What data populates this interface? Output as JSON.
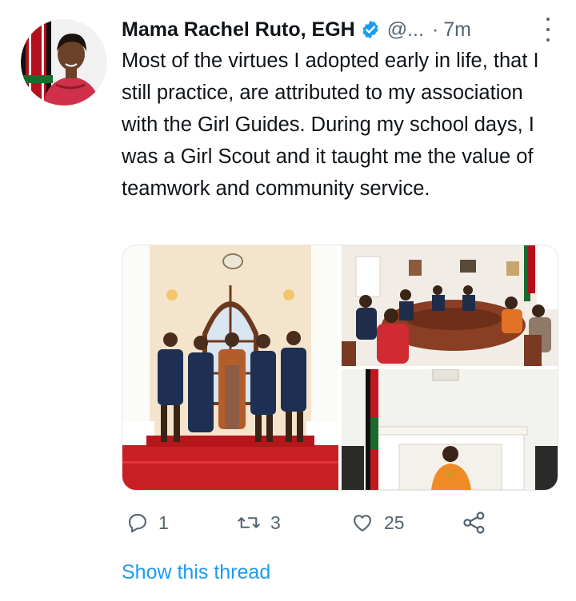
{
  "tweet": {
    "author_name": "Mama Rachel Ruto, EGH",
    "handle": "@...",
    "separator": "·",
    "time": "7m",
    "text": "Most of the virtues I adopted early in life, that I still practice, are attributed to my association with the Girl Guides. During my school days, I was a Girl Scout and it taught me the value of teamwork and community service.",
    "avatar_icon": "profile-photo",
    "verified_icon": "verified-badge-icon",
    "more_icon": "more-options-icon"
  },
  "media": [
    {
      "description_icon": "photo-group-girl-guides"
    },
    {
      "description_icon": "photo-meeting-round-table"
    },
    {
      "description_icon": "photo-seated-by-fireplace"
    }
  ],
  "actions": {
    "reply": {
      "icon": "reply-icon",
      "count": "1"
    },
    "retweet": {
      "icon": "retweet-icon",
      "count": "3"
    },
    "like": {
      "icon": "heart-icon",
      "count": "25"
    },
    "share": {
      "icon": "share-icon"
    }
  },
  "show_thread_label": "Show this thread",
  "colors": {
    "text": "#0f1419",
    "secondary": "#536471",
    "link": "#1d9bf0",
    "verified": "#1d9bf0"
  }
}
